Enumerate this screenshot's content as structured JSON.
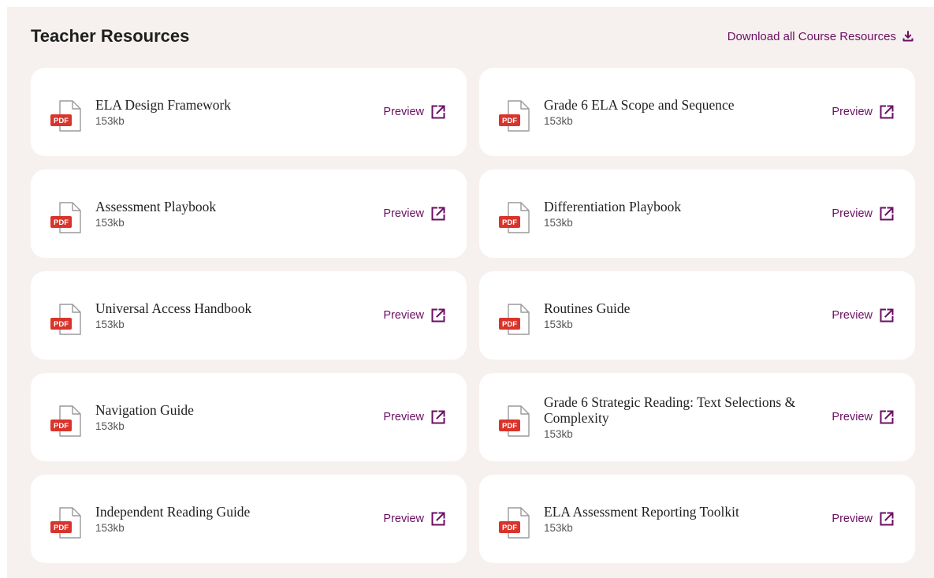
{
  "header": {
    "title": "Teacher Resources",
    "download_label": "Download all Course Resources"
  },
  "icons": {
    "file": "pdf-file-icon",
    "preview": "external-link-icon",
    "download": "download-icon"
  },
  "colors": {
    "accent": "#6b0f63",
    "pdf_badge": "#d9342b",
    "panel_bg": "#f6f1ef",
    "card_bg": "#ffffff"
  },
  "pdf_badge_label": "PDF",
  "preview_label": "Preview",
  "resources": [
    {
      "title": "ELA Design Framework",
      "size": "153kb"
    },
    {
      "title": "Grade 6 ELA Scope and Sequence",
      "size": "153kb"
    },
    {
      "title": "Assessment Playbook",
      "size": "153kb"
    },
    {
      "title": "Differentiation Playbook",
      "size": "153kb"
    },
    {
      "title": "Universal Access Handbook",
      "size": "153kb"
    },
    {
      "title": "Routines Guide",
      "size": "153kb"
    },
    {
      "title": "Navigation Guide",
      "size": "153kb"
    },
    {
      "title": "Grade 6 Strategic Reading: Text Selections & Complexity",
      "size": "153kb"
    },
    {
      "title": "Independent Reading Guide",
      "size": "153kb"
    },
    {
      "title": "ELA Assessment Reporting Toolkit",
      "size": "153kb"
    }
  ]
}
